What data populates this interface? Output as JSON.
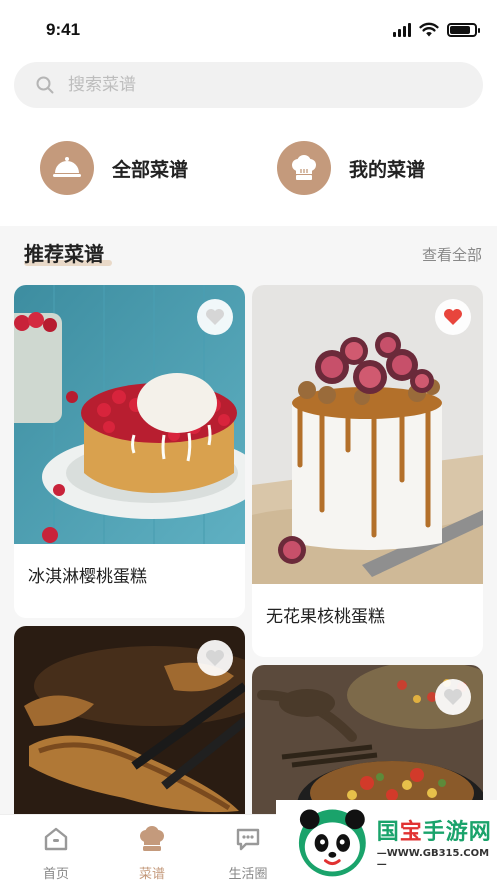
{
  "status": {
    "time": "9:41",
    "battery_level": 0.85
  },
  "search": {
    "placeholder": "搜索菜谱"
  },
  "categories": [
    {
      "label": "全部菜谱",
      "icon": "cloche-icon"
    },
    {
      "label": "我的菜谱",
      "icon": "chef-hat-icon"
    }
  ],
  "section": {
    "title": "推荐菜谱",
    "more": "查看全部"
  },
  "recipes": [
    {
      "name": "冰淇淋樱桃蛋糕",
      "favorited": false
    },
    {
      "name": "无花果核桃蛋糕",
      "favorited": true
    },
    {
      "name": "",
      "favorited": false
    },
    {
      "name": "",
      "favorited": false
    }
  ],
  "tabs": [
    {
      "label": "首页",
      "icon": "home-icon",
      "active": false
    },
    {
      "label": "菜谱",
      "icon": "chef-hat-icon",
      "active": true
    },
    {
      "label": "生活圈",
      "icon": "chat-bubble-icon",
      "active": false
    }
  ],
  "watermark": {
    "name_green_1": "国",
    "name_red": "宝",
    "name_green_2": "手游网",
    "url": "—WWW.GB315.COM—"
  },
  "colors": {
    "accent": "#c49a7c",
    "favorite": "#e8453c",
    "background": "#f6f6f6"
  }
}
